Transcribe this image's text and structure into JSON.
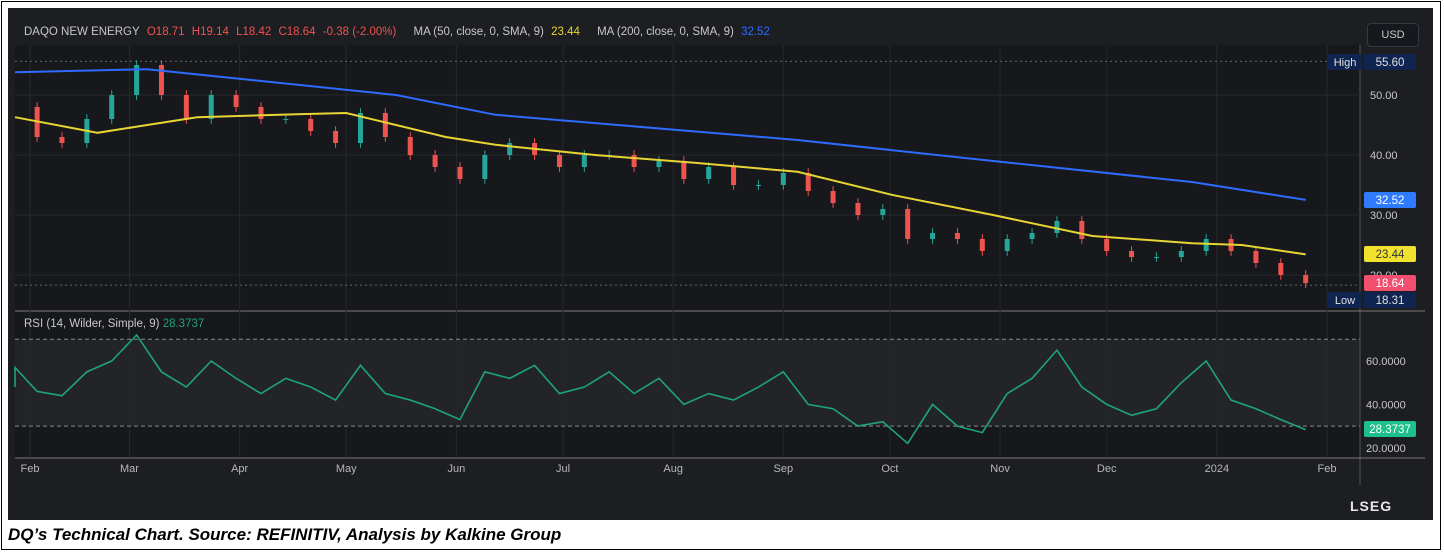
{
  "legend": {
    "name": "DAQO NEW ENERGY",
    "open": "O18.71",
    "high": "H19.14",
    "low": "L18.42",
    "close": "C18.64",
    "change": "-0.38 (-2.00%)",
    "ma50_label": "MA (50, close, 0, SMA, 9)",
    "ma50_value": "23.44",
    "ma200_label": "MA (200, close, 0, SMA, 9)",
    "ma200_value": "32.52"
  },
  "rsi_legend": {
    "label": "RSI (14, Wilder, Simple, 9)",
    "value": "28.3737"
  },
  "currency_button": "USD",
  "price_tags": {
    "high_label": "High",
    "high": "55.60",
    "low_label": "Low",
    "low": "18.31",
    "ma200": "32.52",
    "ma50": "23.44",
    "last": "18.64",
    "rsi": "28.3737"
  },
  "brand": "LSEG",
  "caption": "DQ’s Technical Chart. Source: REFINITIV, Analysis by Kalkine Group",
  "colors": {
    "up": "#26a69a",
    "down": "#ef5350",
    "ma50": "#e8d534",
    "ma200": "#2f6bff",
    "rsi": "#1fa37a",
    "last_tag": "#f0506e",
    "rsi_tag": "#1dbf8a",
    "background": "#1c1e22"
  },
  "chart_data": [
    {
      "type": "candlestick",
      "title": "DAQO NEW ENERGY",
      "ylim": [
        17,
        57
      ],
      "yticks": [
        "50.00",
        "40.00",
        "30.00",
        "20.00"
      ],
      "ytick_values": [
        50,
        40,
        30,
        20
      ],
      "xticks": [
        "Feb",
        "Mar",
        "Apr",
        "May",
        "Jun",
        "Jul",
        "Aug",
        "Sep",
        "Oct",
        "Nov",
        "Dec",
        "2024",
        "Feb"
      ],
      "xtick_dates": [
        "2023-02-01",
        "2023-03-01",
        "2023-04-01",
        "2023-05-01",
        "2023-06-01",
        "2023-07-01",
        "2023-08-01",
        "2023-09-01",
        "2023-10-01",
        "2023-11-01",
        "2023-12-01",
        "2024-01-01",
        "2024-02-01"
      ],
      "high_line": 55.6,
      "low_line": 18.31,
      "dates": [
        "2023-01-20",
        "2023-01-27",
        "2023-02-03",
        "2023-02-10",
        "2023-02-17",
        "2023-02-24",
        "2023-03-03",
        "2023-03-10",
        "2023-03-17",
        "2023-03-24",
        "2023-03-31",
        "2023-04-07",
        "2023-04-14",
        "2023-04-21",
        "2023-04-28",
        "2023-05-05",
        "2023-05-12",
        "2023-05-19",
        "2023-05-26",
        "2023-06-02",
        "2023-06-09",
        "2023-06-16",
        "2023-06-23",
        "2023-06-30",
        "2023-07-07",
        "2023-07-14",
        "2023-07-21",
        "2023-07-28",
        "2023-08-04",
        "2023-08-11",
        "2023-08-18",
        "2023-08-25",
        "2023-09-01",
        "2023-09-08",
        "2023-09-15",
        "2023-09-22",
        "2023-09-29",
        "2023-10-06",
        "2023-10-13",
        "2023-10-20",
        "2023-10-27",
        "2023-11-03",
        "2023-11-10",
        "2023-11-17",
        "2023-11-24",
        "2023-12-01",
        "2023-12-08",
        "2023-12-15",
        "2023-12-22",
        "2023-12-29",
        "2024-01-05",
        "2024-01-12",
        "2024-01-19",
        "2024-01-26"
      ],
      "close": [
        45,
        48,
        43,
        42,
        46,
        50,
        55,
        50,
        46,
        50,
        48,
        46,
        46,
        44,
        42,
        47,
        43,
        40,
        38,
        36,
        40,
        42,
        40,
        38,
        40,
        40,
        38,
        39,
        36,
        38,
        35,
        35,
        37,
        34,
        32,
        30,
        31,
        26,
        27,
        26,
        24,
        26,
        27,
        29,
        26,
        24,
        23,
        23,
        24,
        26,
        24,
        22,
        20,
        18.64
      ],
      "series": [
        {
          "name": "MA (50, close, 0, SMA, 9)",
          "dates": [
            "2023-01-27",
            "2023-02-20",
            "2023-03-06",
            "2023-03-20",
            "2023-04-17",
            "2023-05-01",
            "2023-05-15",
            "2023-05-29",
            "2023-06-12",
            "2023-07-10",
            "2023-08-07",
            "2023-09-05",
            "2023-10-02",
            "2023-10-30",
            "2023-11-27",
            "2023-12-25",
            "2024-01-08",
            "2024-01-26"
          ],
          "values": [
            46.3,
            43.7,
            45,
            46.3,
            46.8,
            47,
            45,
            43,
            41.7,
            40,
            38.7,
            37.2,
            33.3,
            30,
            26.5,
            25.3,
            25,
            23.44
          ]
        },
        {
          "name": "MA (200, close, 0, SMA, 9)",
          "dates": [
            "2023-01-27",
            "2023-03-06",
            "2023-05-15",
            "2023-06-12",
            "2023-09-05",
            "2023-10-30",
            "2023-12-25",
            "2024-01-26"
          ],
          "values": [
            53.8,
            54.3,
            50,
            46.7,
            42.5,
            39,
            35.5,
            32.52
          ]
        }
      ]
    },
    {
      "type": "line",
      "title": "RSI (14, Wilder, Simple, 9)",
      "ylim": [
        17,
        80
      ],
      "yticks": [
        "60.0000",
        "40.0000",
        "20.0000"
      ],
      "ytick_values": [
        60,
        40,
        20
      ],
      "bands": [
        70,
        30
      ],
      "dates_ref": "same as candlestick dates",
      "values": [
        48,
        57,
        46,
        44,
        55,
        60,
        72,
        55,
        48,
        60,
        52,
        45,
        52,
        48,
        42,
        58,
        45,
        42,
        38,
        33,
        55,
        52,
        58,
        45,
        48,
        55,
        45,
        52,
        40,
        45,
        42,
        48,
        55,
        40,
        38,
        30,
        32,
        22,
        40,
        30,
        27,
        45,
        52,
        65,
        48,
        40,
        35,
        38,
        50,
        60,
        42,
        38,
        33,
        28.37
      ]
    }
  ]
}
